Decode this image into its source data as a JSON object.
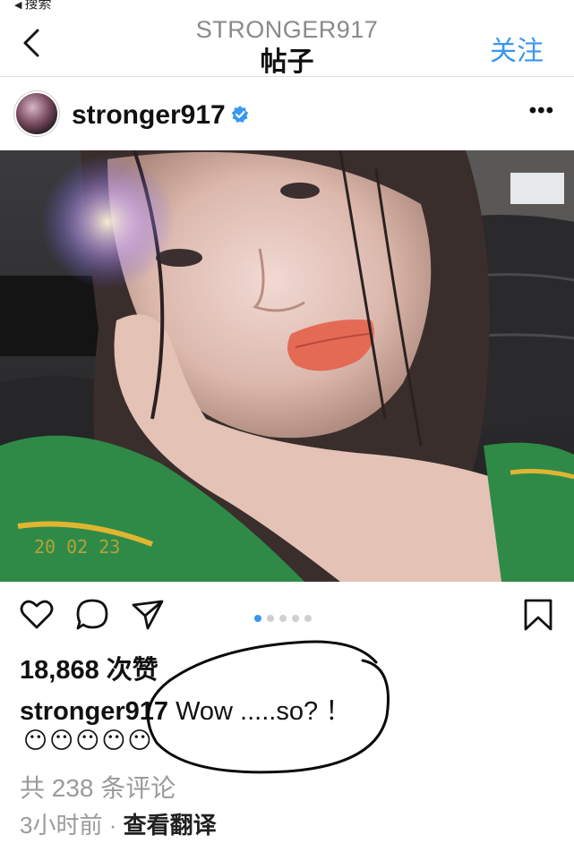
{
  "status_bar": {
    "back_label": "搜索"
  },
  "nav": {
    "account": "STRONGER917",
    "title": "帖子",
    "follow_label": "关注"
  },
  "post": {
    "username": "stronger917",
    "verified": true,
    "photo_date_stamp": "20 02 23",
    "carousel": {
      "count": 5,
      "active_index": 0
    },
    "likes": "18,868 次赞",
    "caption_user": "stronger917",
    "caption_text": " Wow .....so? ！",
    "emojis": "😶😶😶😶😶",
    "comments": "共 238 条评论",
    "time_ago": "3小时前",
    "separator": " · ",
    "translate": "查看翻译"
  },
  "colors": {
    "accent": "#3897f0",
    "muted": "#9a9a9a",
    "text": "#111111"
  }
}
